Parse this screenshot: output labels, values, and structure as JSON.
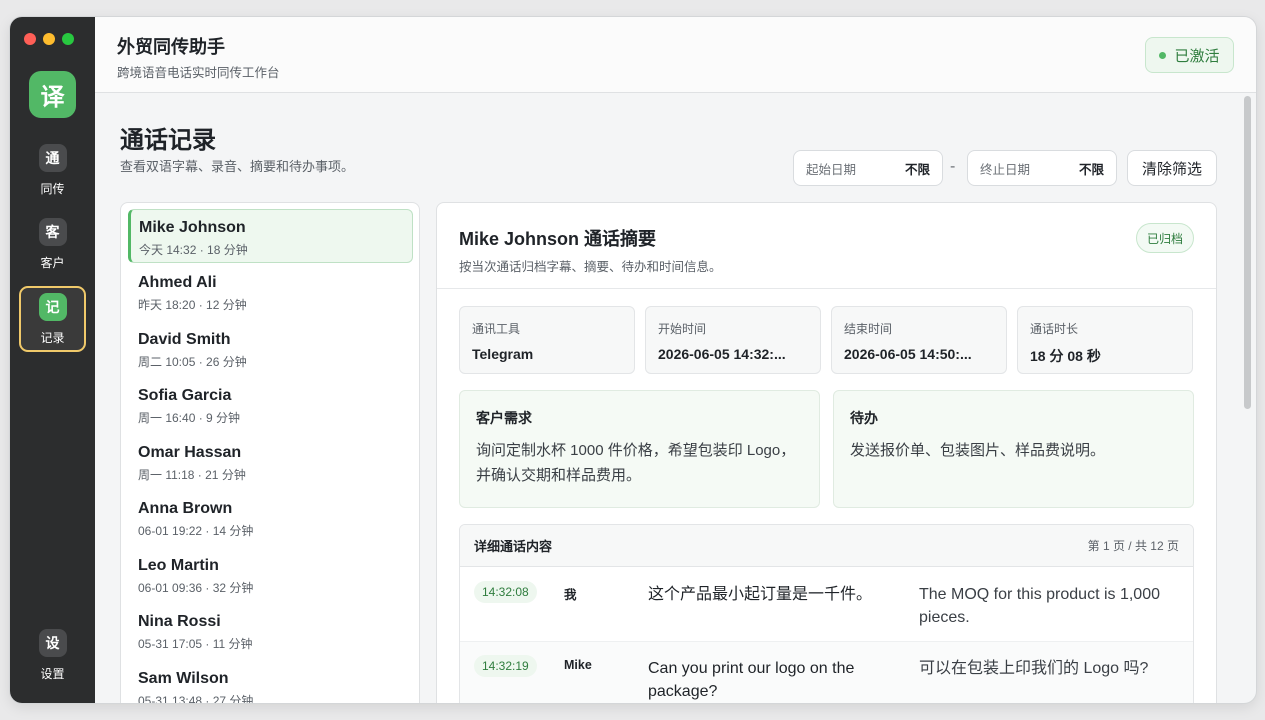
{
  "sidebar": {
    "logo": "译",
    "items": [
      {
        "icon": "通",
        "label": "同传"
      },
      {
        "icon": "客",
        "label": "客户"
      },
      {
        "icon": "记",
        "label": "记录"
      },
      {
        "icon": "设",
        "label": "设置"
      }
    ]
  },
  "header": {
    "title": "外贸同传助手",
    "subtitle": "跨境语音电话实时同传工作台",
    "status": "已激活"
  },
  "page": {
    "title": "通话记录",
    "subtitle": "查看双语字幕、录音、摘要和待办事项。"
  },
  "filters": {
    "start": {
      "label": "起始日期",
      "value": "不限"
    },
    "end": {
      "label": "终止日期",
      "value": "不限"
    },
    "separator": "-",
    "clear": "清除筛选"
  },
  "calls": [
    {
      "name": "Mike Johnson",
      "meta": "今天 14:32 · 18 分钟"
    },
    {
      "name": "Ahmed Ali",
      "meta": "昨天 18:20 · 12 分钟"
    },
    {
      "name": "David Smith",
      "meta": "周二 10:05 · 26 分钟"
    },
    {
      "name": "Sofia Garcia",
      "meta": "周一 16:40 · 9 分钟"
    },
    {
      "name": "Omar Hassan",
      "meta": "周一 11:18 · 21 分钟"
    },
    {
      "name": "Anna Brown",
      "meta": "06-01 19:22 · 14 分钟"
    },
    {
      "name": "Leo Martin",
      "meta": "06-01 09:36 · 32 分钟"
    },
    {
      "name": "Nina Rossi",
      "meta": "05-31 17:05 · 11 分钟"
    },
    {
      "name": "Sam Wilson",
      "meta": "05-31 13:48 · 27 分钟"
    }
  ],
  "detail": {
    "title": "Mike Johnson 通话摘要",
    "subtitle": "按当次通话归档字幕、摘要、待办和时间信息。",
    "badge": "已归档",
    "info": [
      {
        "label": "通讯工具",
        "value": "Telegram"
      },
      {
        "label": "开始时间",
        "value": "2026-06-05 14:32:..."
      },
      {
        "label": "结束时间",
        "value": "2026-06-05 14:50:..."
      },
      {
        "label": "通话时长",
        "value": "18 分 08 秒"
      }
    ],
    "needs": {
      "title": "客户需求",
      "body": "询问定制水杯 1000 件价格，希望包装印 Logo，并确认交期和样品费用。"
    },
    "todo": {
      "title": "待办",
      "body": "发送报价单、包装图片、样品费说明。"
    },
    "transcript": {
      "title": "详细通话内容",
      "page": "第 1 页 / 共 12 页",
      "rows": [
        {
          "time": "14:32:08",
          "speaker": "我",
          "original": "这个产品最小起订量是一千件。",
          "translation": "The MOQ for this product is 1,000 pieces."
        },
        {
          "time": "14:32:19",
          "speaker": "Mike",
          "original": "Can you print our logo on the package?",
          "translation": "可以在包装上印我们的 Logo 吗?"
        }
      ]
    }
  }
}
